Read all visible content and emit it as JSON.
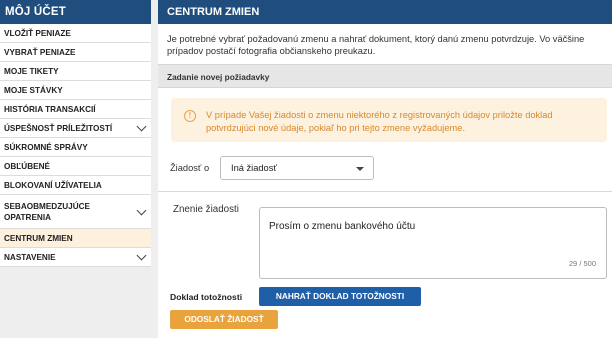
{
  "sidebar": {
    "title": "MÔJ ÚČET",
    "items": [
      {
        "label": "VLOŽIŤ PENIAZE"
      },
      {
        "label": "VYBRAŤ PENIAZE"
      },
      {
        "label": "MOJE TIKETY"
      },
      {
        "label": "MOJE STÁVKY"
      },
      {
        "label": "HISTÓRIA TRANSAKCIÍ"
      },
      {
        "label": "ÚSPEŠNOSŤ PRÍLEŽITOSTÍ"
      },
      {
        "label": "SÚKROMNÉ SPRÁVY"
      },
      {
        "label": "OBĽÚBENÉ"
      },
      {
        "label": "BLOKOVANÍ UŽÍVATELIA"
      },
      {
        "label": "SEBAOBMEDZUJÚCE OPATRENIA"
      },
      {
        "label": "CENTRUM ZMIEN"
      },
      {
        "label": "NASTAVENIE"
      }
    ],
    "active_color": "#fdf0dc"
  },
  "main": {
    "title": "CENTRUM ZMIEN",
    "intro": "Je potrebné vybrať požadovanú zmenu a nahrať dokument, ktorý danú zmenu potvrdzuje. Vo väčšine prípadov postačí fotografia občianskeho preukazu.",
    "section_title": "Zadanie novej požiadavky",
    "alert": {
      "icon": "exclamation-icon",
      "text": "V prípade Vašej žiadosti o zmenu niektorého z registrovaných údajov priložte doklad potvrdzujúci nové údaje, pokiaľ ho pri tejto zmene vyžadujeme."
    },
    "request_label": "Žiadosť o",
    "request_value": "Iná žiadosť",
    "change_label": "Znenie žiadosti",
    "change_value": "Prosím o zmenu bankového účtu",
    "char_counter": "29 / 500",
    "doc_label": "Doklad totožnosti",
    "upload_button": "NAHRAŤ DOKLAD TOTOŽNOSTI",
    "send_button": "ODOSLAŤ ŽIADOSŤ"
  },
  "colors": {
    "header_blue": "#1f4e7e",
    "upload_blue": "#1e5fa8",
    "send_orange": "#e9a33d",
    "alert_bg": "#fdf1e0"
  }
}
